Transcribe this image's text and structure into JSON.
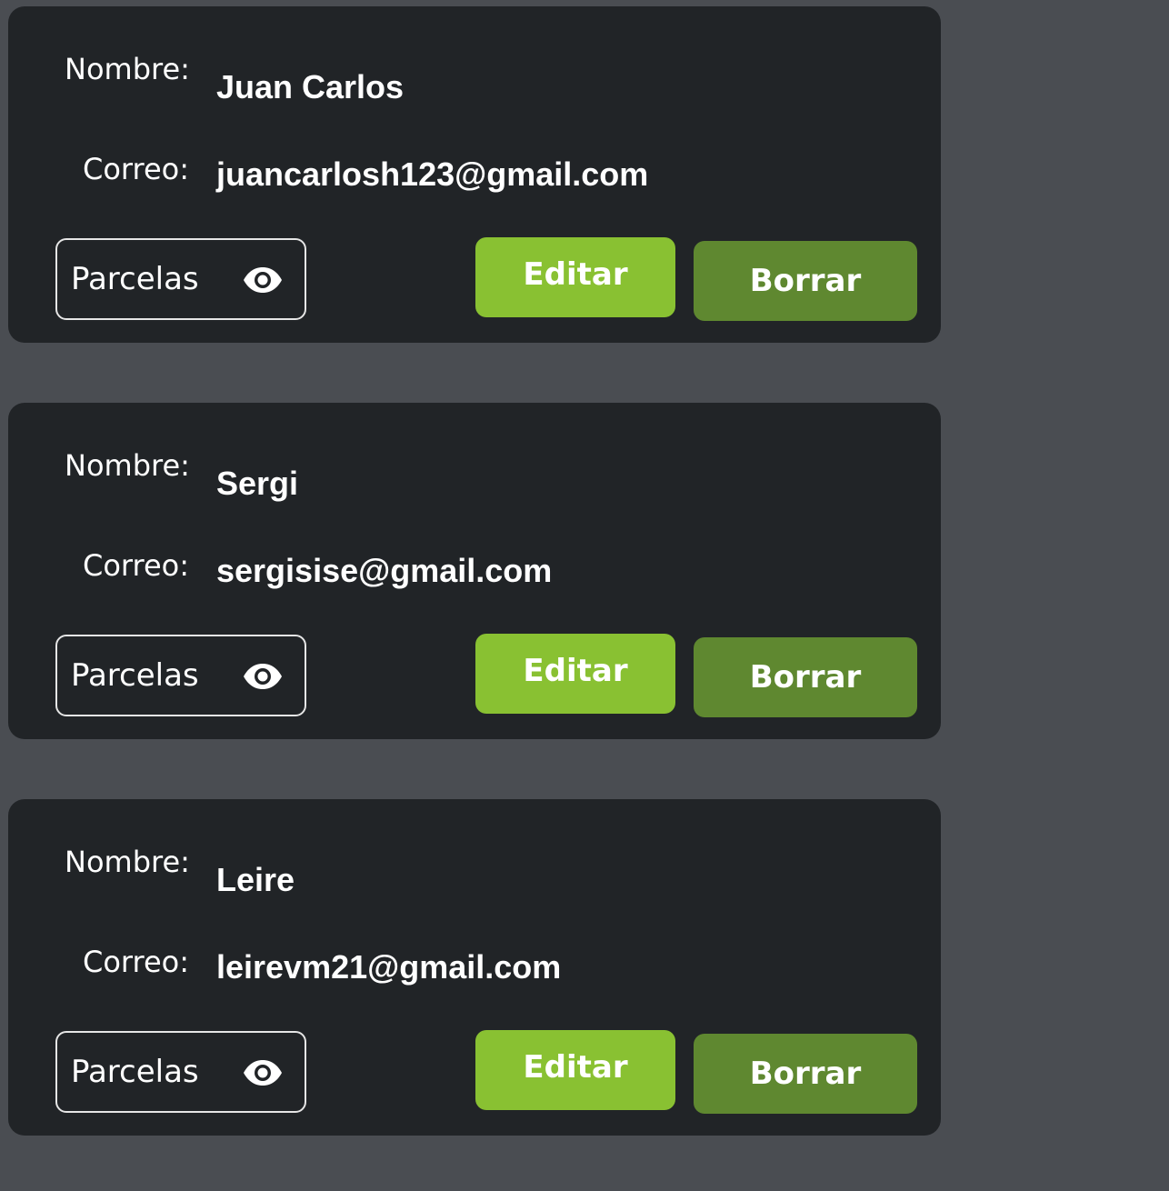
{
  "users": [
    {
      "nombre_label": "Nombre:",
      "nombre": "Juan Carlos",
      "correo_label": "Correo:",
      "correo": "juancarlosh123@gmail.com",
      "parcelas_label": "Parcelas",
      "parcelas_icon": "eye-icon",
      "editar_label": "Editar",
      "borrar_label": "Borrar"
    },
    {
      "nombre_label": "Nombre:",
      "nombre": "Sergi",
      "correo_label": "Correo:",
      "correo": "sergisise@gmail.com",
      "parcelas_label": "Parcelas",
      "parcelas_icon": "eye-icon",
      "editar_label": "Editar",
      "borrar_label": "Borrar"
    },
    {
      "nombre_label": "Nombre:",
      "nombre": "Leire",
      "correo_label": "Correo:",
      "correo": "leirevm21@gmail.com",
      "parcelas_label": "Parcelas",
      "parcelas_icon": "eye-icon",
      "editar_label": "Editar",
      "borrar_label": "Borrar"
    }
  ],
  "colors": {
    "page_background": "#4a4d52",
    "card_background": "#212427",
    "editar_button": "#89c132",
    "borrar_button": "#5f8830",
    "text": "#ffffff"
  }
}
